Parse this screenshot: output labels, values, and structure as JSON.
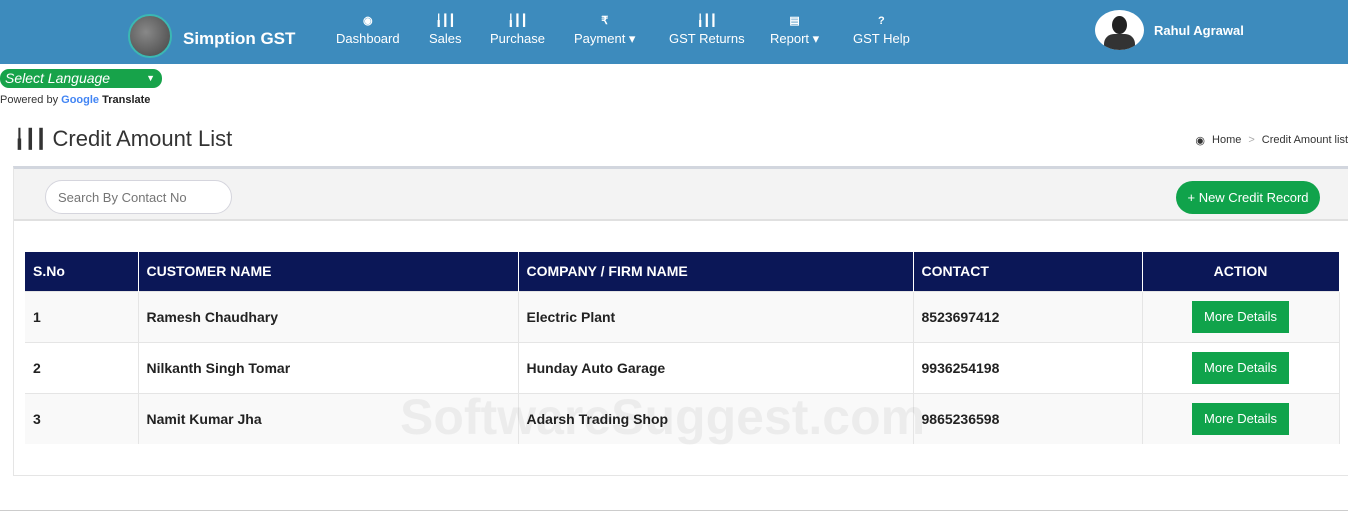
{
  "header": {
    "brand": "Simption GST",
    "user": "Rahul Agrawal",
    "nav": [
      {
        "label": "Dashboard",
        "icon": "dashboard-icon",
        "glyph": "◉"
      },
      {
        "label": "Sales",
        "icon": "bar-chart-icon",
        "glyph": "╽┃┃"
      },
      {
        "label": "Purchase",
        "icon": "bar-chart-icon",
        "glyph": "╽┃┃"
      },
      {
        "label": "Payment ▾",
        "icon": "rupee-icon",
        "glyph": "₹"
      },
      {
        "label": "GST Returns",
        "icon": "bar-chart-icon",
        "glyph": "╽┃┃"
      },
      {
        "label": "Report ▾",
        "icon": "document-icon",
        "glyph": "▤"
      },
      {
        "label": "GST Help",
        "icon": "question-icon",
        "glyph": "?"
      }
    ]
  },
  "translate": {
    "select": "Select Language",
    "powered": "Powered by",
    "google": "Google",
    "translate": "Translate"
  },
  "page": {
    "title": "Credit Amount List",
    "breadcrumb": [
      "Home",
      "Credit Amount list"
    ]
  },
  "toolbar": {
    "search_placeholder": "Search By Contact No",
    "new_button": "+ New Credit Record"
  },
  "table": {
    "headers": [
      "S.No",
      "CUSTOMER NAME",
      "COMPANY / FIRM NAME",
      "CONTACT",
      "ACTION"
    ],
    "rows": [
      [
        "1",
        "Ramesh Chaudhary",
        "Electric Plant",
        "8523697412",
        "More Details"
      ],
      [
        "2",
        "Nilkanth Singh Tomar",
        "Hunday Auto Garage",
        "9936254198",
        "More Details"
      ],
      [
        "3",
        "Namit Kumar Jha",
        "Adarsh Trading Shop",
        "9865236598",
        "More Details"
      ]
    ]
  },
  "watermark": "SoftwareSuggest.com"
}
